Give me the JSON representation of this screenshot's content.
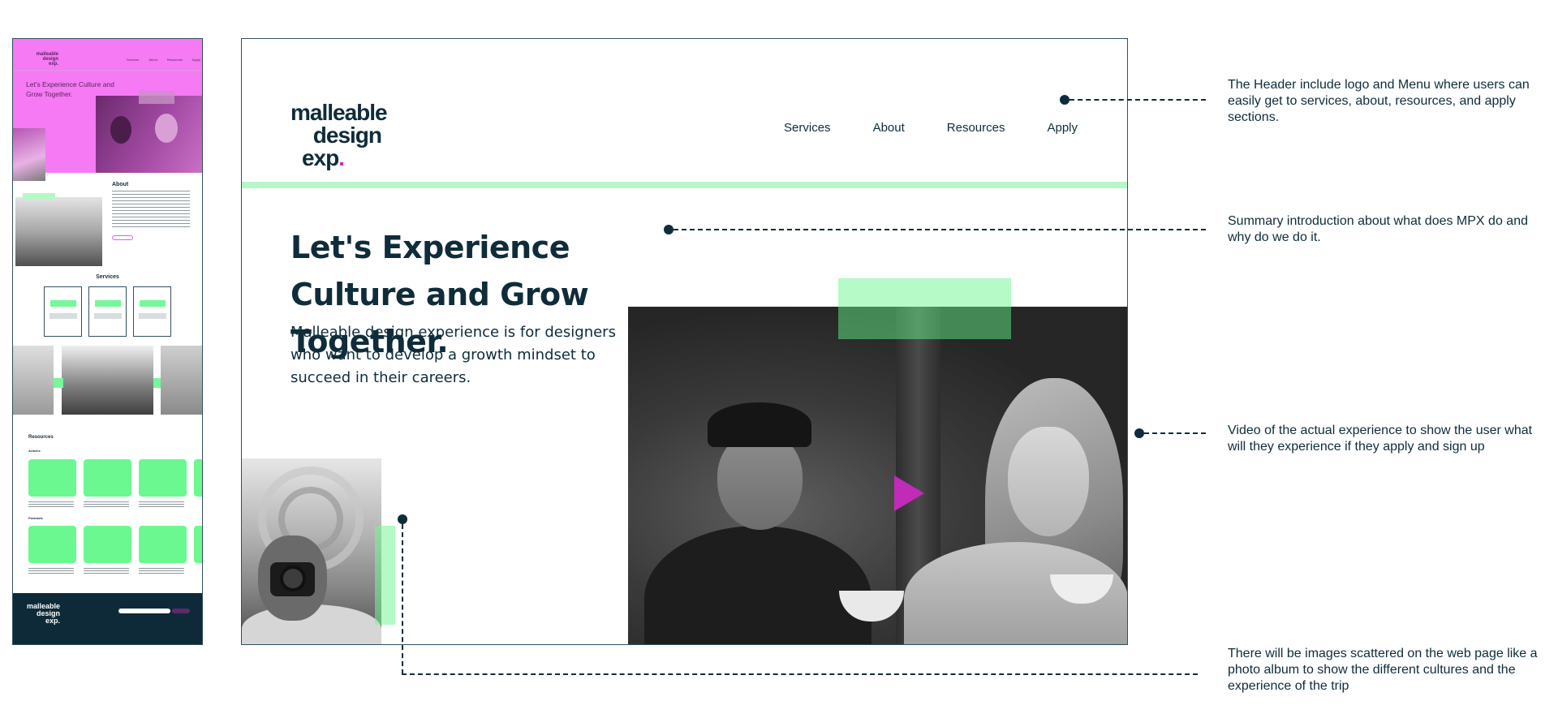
{
  "thumbnail": {
    "logo": [
      "malleable",
      "design",
      "exp."
    ],
    "nav": [
      "Services",
      "About",
      "Resources",
      "Apply"
    ],
    "headline": "Let's Experience Culture and Grow Together.",
    "about_title": "About",
    "services_title": "Services",
    "service_cards": [
      "Growth Mindset Mentor",
      "Culture Experience",
      "Design Network Community"
    ],
    "resources_title": "Resources",
    "articles_label": "Articles",
    "podcasts_label": "Podcasts",
    "footer_logo": [
      "malleable",
      "design",
      "exp."
    ],
    "colors": {
      "hero_overlay": "#f57af3",
      "green_card": "#6cf890",
      "footer": "#0e2a38"
    }
  },
  "header": {
    "logo": {
      "line1": "malleable",
      "line2": "design",
      "line3": "exp",
      "dot": "."
    },
    "nav": [
      "Services",
      "About",
      "Resources",
      "Apply"
    ]
  },
  "hero": {
    "headline": {
      "p1": "Let's ",
      "b1": "Experience",
      "p2": " Culture and ",
      "b2": "Grow",
      "p3": " Together."
    },
    "intro": "Malleable design experience is for designers who want to develop a growth mindset to succeed in their careers."
  },
  "video": {
    "play_icon": "play-icon",
    "accent": "#c02bb8"
  },
  "annotations": {
    "header": "The Header include logo and Menu where users can easily get to services, about, resources, and apply sections.",
    "summary": "Summary introduction about what does MPX do and why do we do it.",
    "video": "Video of the actual experience to show the user what will they experience if they apply and sign up",
    "images": "There will be images scattered on the web page like a photo album to show the different cultures and the experience of the trip"
  },
  "colors": {
    "text": "#0f2c3a",
    "green_rule": "#b7f6c8",
    "logo_dot": "#d221c9"
  }
}
